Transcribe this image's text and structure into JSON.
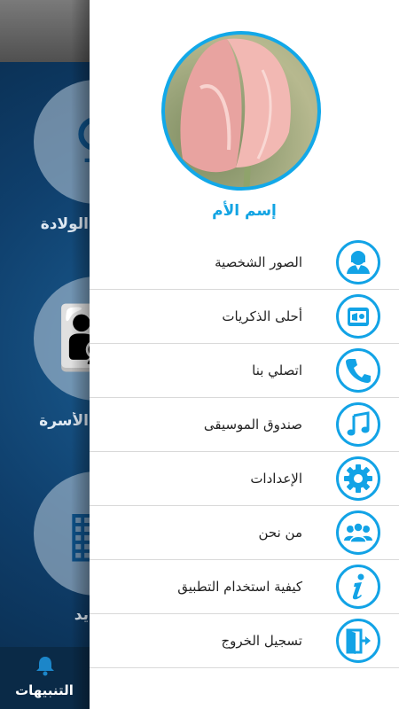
{
  "background": {
    "tiles": [
      {
        "name": "birth-tile",
        "label": "الولادة"
      },
      {
        "name": "family-tile",
        "label": "الأسرة"
      },
      {
        "name": "dates-tile",
        "label": "يد"
      }
    ],
    "bottom_nav": {
      "label": "التنبيهات",
      "icon": "bell-icon"
    }
  },
  "drawer": {
    "mother_name": "إسم الأم",
    "items": [
      {
        "label": "الصور الشخصية",
        "icon": "user-avatar-icon"
      },
      {
        "label": "أحلى الذكريات",
        "icon": "memories-icon"
      },
      {
        "label": "اتصلي بنا",
        "icon": "phone-icon"
      },
      {
        "label": "صندوق الموسيقى",
        "icon": "music-note-icon"
      },
      {
        "label": "الإعدادات",
        "icon": "gear-icon"
      },
      {
        "label": "من نحن",
        "icon": "group-icon"
      },
      {
        "label": "كيفية استخدام التطبيق",
        "icon": "info-icon"
      },
      {
        "label": "تسجيل الخروج",
        "icon": "logout-icon"
      }
    ]
  },
  "colors": {
    "accent": "#12a3e6",
    "divider": "#d9d9d9",
    "text": "#222222"
  }
}
